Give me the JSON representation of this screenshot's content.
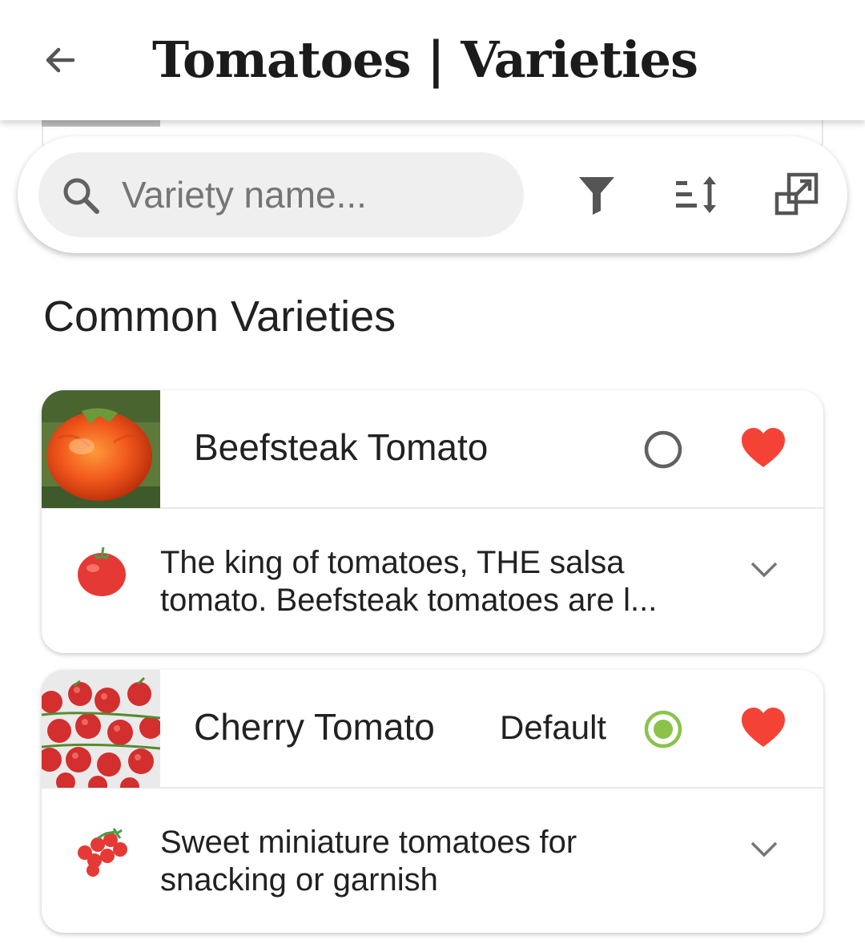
{
  "app_bar": {
    "title": "Tomatoes | Varieties",
    "back_icon": "arrow-left-icon"
  },
  "search": {
    "placeholder": "Variety name...",
    "value": "",
    "icons": [
      "search-icon",
      "filter-icon",
      "sort-icon",
      "open-external-icon"
    ]
  },
  "section": {
    "title": "Common Varieties"
  },
  "varieties": [
    {
      "name": "Beefsteak Tomato",
      "default_label": "",
      "selected": false,
      "favorite": true,
      "description": "The king of tomatoes, THE salsa tomato. Beefsteak tomatoes are l...",
      "thumb": "beefsteak-photo",
      "icon": "tomato-icon"
    },
    {
      "name": "Cherry Tomato",
      "default_label": "Default",
      "selected": true,
      "favorite": true,
      "description": "Sweet miniature tomatoes for snacking or garnish",
      "thumb": "cherry-photo",
      "icon": "cherry-tomatoes-icon"
    }
  ],
  "colors": {
    "heart": "#f44336",
    "radio_selected": "#8bc34a",
    "radio_unselected": "#616161",
    "icon_gray": "#555555"
  }
}
